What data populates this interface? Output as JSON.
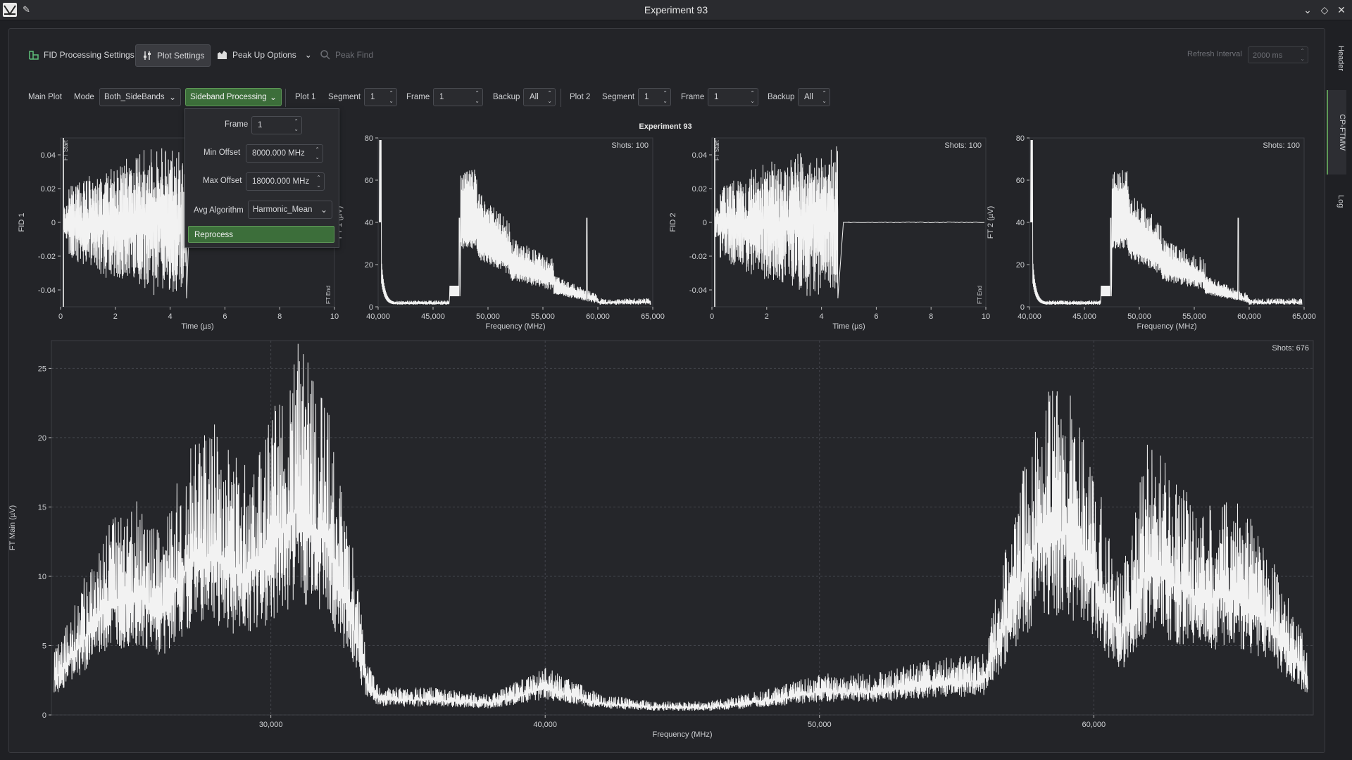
{
  "window": {
    "title": "Experiment 93"
  },
  "toolbar": {
    "fid_processing": "FID Processing Settings",
    "plot_settings": "Plot Settings",
    "peak_up": "Peak Up Options",
    "peak_find": "Peak Find",
    "refresh_label": "Refresh Interval",
    "refresh_value": "2000 ms"
  },
  "controls": {
    "main_plot": "Main Plot",
    "mode_label": "Mode",
    "mode_value": "Both_SideBands",
    "sideband_btn": "Sideband Processing",
    "plot1": "Plot 1",
    "plot2": "Plot 2",
    "segment_label": "Segment",
    "frame_label": "Frame",
    "backup_label": "Backup",
    "p1_segment": "1",
    "p1_frame": "1",
    "p1_backup": "All",
    "p2_segment": "1",
    "p2_frame": "1",
    "p2_backup": "All"
  },
  "popup": {
    "frame_label": "Frame",
    "frame_value": "1",
    "min_label": "Min Offset",
    "min_value": "8000.000 MHz",
    "max_label": "Max Offset",
    "max_value": "18000.000 MHz",
    "algo_label": "Avg Algorithm",
    "algo_value": "Harmonic_Mean",
    "reprocess": "Reprocess"
  },
  "sidetabs": [
    "Header",
    "CP-FTMW",
    "Log"
  ],
  "plot_title": "Experiment 93",
  "colors": {
    "accent": "#5f9a58",
    "accent_bg": "#3c6e3a",
    "trace": "#f2f2f2",
    "plot_bg": "#25262a"
  },
  "chart_data": [
    {
      "id": "fid1",
      "type": "line",
      "xlabel": "Time (µs)",
      "ylabel": "FID 1",
      "xlim": [
        0,
        10
      ],
      "ylim": [
        -0.05,
        0.05
      ],
      "xticks": [
        "0",
        "2",
        "4",
        "6",
        "8",
        "10"
      ],
      "yticks": [
        "-0.04",
        "-0.02",
        "0",
        "0.02",
        "0.04"
      ],
      "markers": [
        "FT Start",
        "FT End"
      ]
    },
    {
      "id": "ft1",
      "type": "line",
      "xlabel": "Frequency (MHz)",
      "ylabel": "FT 1 (µV)",
      "xlim": [
        40000,
        65000
      ],
      "ylim": [
        0,
        80
      ],
      "xticks": [
        "40,000",
        "45,000",
        "50,000",
        "55,000",
        "60,000",
        "65,000"
      ],
      "yticks": [
        "0",
        "20",
        "40",
        "60",
        "80"
      ],
      "annotation": "Shots: 100"
    },
    {
      "id": "fid2",
      "type": "line",
      "xlabel": "Time (µs)",
      "ylabel": "FID 2",
      "xlim": [
        0,
        10
      ],
      "ylim": [
        -0.05,
        0.05
      ],
      "xticks": [
        "0",
        "2",
        "4",
        "6",
        "8",
        "10"
      ],
      "yticks": [
        "-0.04",
        "-0.02",
        "0",
        "0.02",
        "0.04"
      ],
      "markers": [
        "FT Start",
        "FT End"
      ],
      "annotation": "Shots: 100"
    },
    {
      "id": "ft2",
      "type": "line",
      "xlabel": "Frequency (MHz)",
      "ylabel": "FT 2 (µV)",
      "xlim": [
        40000,
        65000
      ],
      "ylim": [
        0,
        80
      ],
      "xticks": [
        "40,000",
        "45,000",
        "50,000",
        "55,000",
        "60,000",
        "65,000"
      ],
      "yticks": [
        "0",
        "20",
        "40",
        "60",
        "80"
      ],
      "annotation": "Shots: 100"
    },
    {
      "id": "main",
      "type": "line",
      "xlabel": "Frequency (MHz)",
      "ylabel": "FT Main (µV)",
      "xlim": [
        22000,
        68000
      ],
      "ylim": [
        0,
        27
      ],
      "xticks": [
        "30,000",
        "40,000",
        "50,000",
        "60,000"
      ],
      "yticks": [
        "0",
        "5",
        "10",
        "15",
        "20",
        "25"
      ],
      "annotation": "Shots: 676",
      "grid": true,
      "envelope": {
        "x": [
          22000,
          23000,
          24000,
          25000,
          26000,
          27000,
          28000,
          29000,
          30000,
          31000,
          32000,
          33000,
          33500,
          34000,
          36000,
          38000,
          40000,
          42000,
          44000,
          46000,
          48000,
          50000,
          52000,
          54000,
          56000,
          57000,
          58000,
          59000,
          60000,
          61000,
          62000,
          63000,
          64000,
          65000,
          66000,
          67000,
          67800
        ],
        "y": [
          4,
          9,
          14,
          16,
          13,
          20,
          21,
          18,
          22,
          27,
          23,
          12,
          4,
          2,
          2,
          1.5,
          3.5,
          1.5,
          1,
          1,
          1.8,
          3,
          3,
          4,
          4.5,
          14,
          23,
          24,
          18,
          10,
          20,
          17,
          15,
          16,
          14,
          9,
          5
        ]
      }
    }
  ]
}
